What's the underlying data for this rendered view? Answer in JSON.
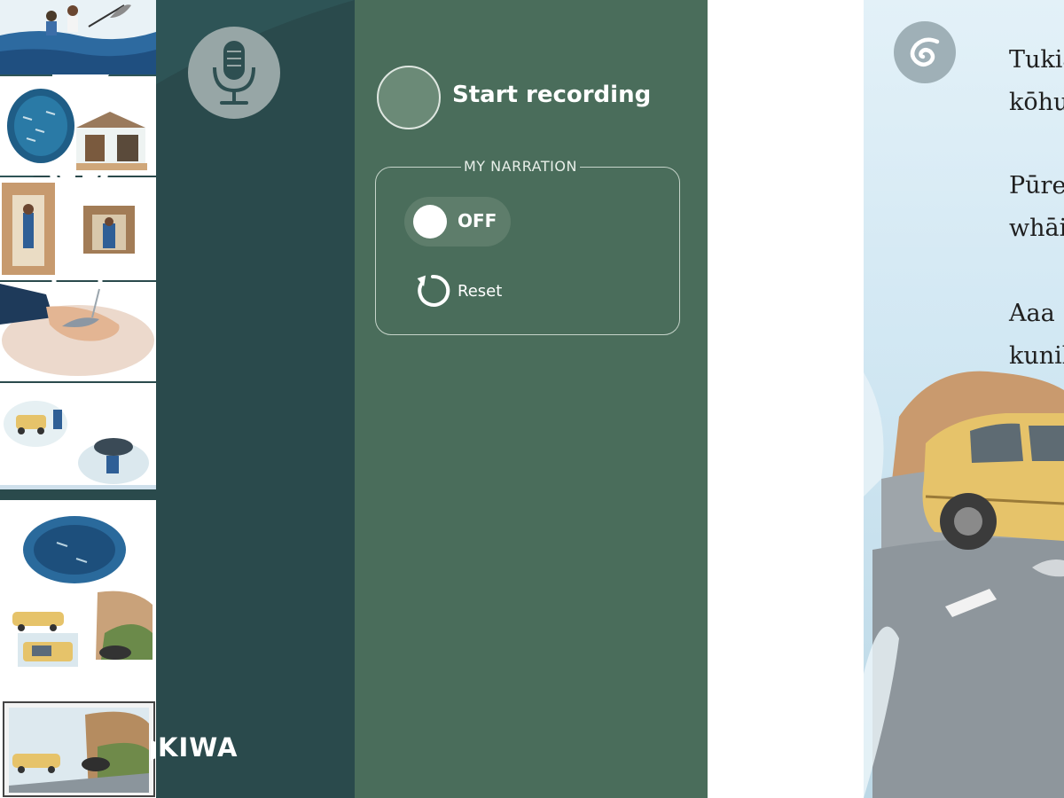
{
  "sidebar": {
    "play_icon": "play-icon",
    "info_icon": "info-icon",
    "notes_icon": "notepad-icon",
    "mic_icon": "microphone-icon",
    "brand": "KIWA"
  },
  "recording": {
    "start_label": "Start recording",
    "narration_legend": "MY NARRATION",
    "toggle_label": "OFF",
    "reset_label": "Reset"
  },
  "story": {
    "lines": [
      "Tukia",
      "kōhu",
      "Pūre",
      "whāi",
      "Aaa",
      "kunik"
    ]
  },
  "colors": {
    "nav_bg": "#2a4a4c",
    "panel_bg": "#4a6d5b",
    "accent_circle": "#97a6a6"
  }
}
